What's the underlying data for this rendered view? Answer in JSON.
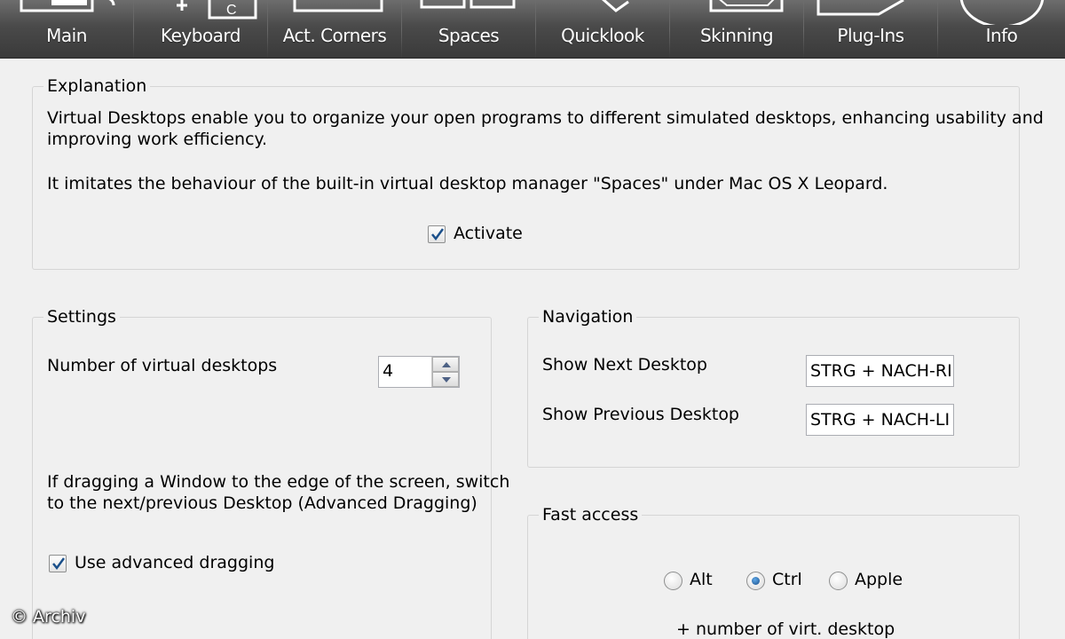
{
  "toolbar": {
    "tabs": [
      {
        "label": "Main",
        "icon": "main-icon"
      },
      {
        "label": "Keyboard",
        "icon": "keyboard-icon"
      },
      {
        "label": "Act. Corners",
        "icon": "active-corners-icon"
      },
      {
        "label": "Spaces",
        "icon": "spaces-icon"
      },
      {
        "label": "Quicklook",
        "icon": "quicklook-icon"
      },
      {
        "label": "Skinning",
        "icon": "skinning-icon"
      },
      {
        "label": "Plug-Ins",
        "icon": "plugins-icon"
      },
      {
        "label": "Info",
        "icon": "info-icon"
      }
    ],
    "active_tab": "Spaces",
    "keyboard_key_glyph": "C"
  },
  "explanation": {
    "title": "Explanation",
    "line1": "Virtual Desktops enable you to organize your open programs to different simulated desktops, enhancing usability and",
    "line2": "improving work efficiency.",
    "line3": "It imitates the behaviour of the built-in virtual desktop manager \"Spaces\" under Mac OS X Leopard.",
    "activate_label": "Activate",
    "activate_checked": true
  },
  "settings": {
    "title": "Settings",
    "num_desktops_label": "Number of virtual desktops",
    "num_desktops_value": "4",
    "dragging_line1": "If dragging a Window to the edge of the screen, switch",
    "dragging_line2": "to the next/previous Desktop (Advanced Dragging)",
    "advanced_dragging_label": "Use advanced dragging",
    "advanced_dragging_checked": true
  },
  "navigation": {
    "title": "Navigation",
    "next_label": "Show Next Desktop",
    "next_value": "STRG + NACH-RI",
    "prev_label": "Show Previous Desktop",
    "prev_value": "STRG + NACH-LI"
  },
  "fast_access": {
    "title": "Fast access",
    "options": [
      "Alt",
      "Ctrl",
      "Apple"
    ],
    "selected": "Ctrl",
    "suffix": "+ number of virt. desktop"
  },
  "watermark": "© Archiv",
  "colors": {
    "toolbar_top": "#6d6d6d",
    "toolbar_bottom": "#3a3a3a",
    "background": "#f0f0f0",
    "check_accent": "#1a4f8a"
  }
}
